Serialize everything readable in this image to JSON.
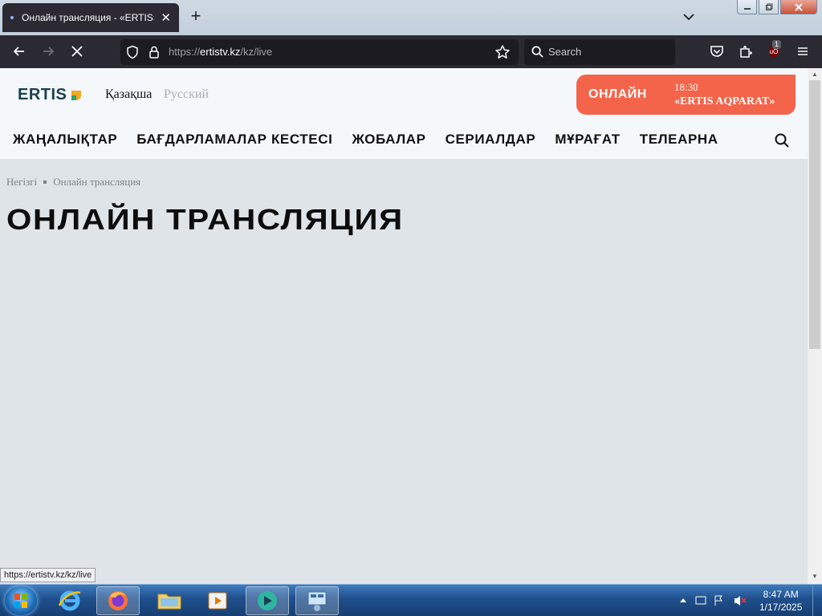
{
  "browser": {
    "tab_title": "Онлайн трансляция - «ERTIS»",
    "tab_close": "✕",
    "new_tab": "+",
    "url_prefix": "https://",
    "url_host": "ertistv.kz",
    "url_path": "/kz/live",
    "search_placeholder": "Search",
    "extension_badge": "1",
    "status_url": "https://ertistv.kz/kz/live"
  },
  "site": {
    "logo_text": "ERTIS",
    "lang_kz": "Қазақша",
    "lang_ru": "Русский",
    "live": {
      "label": "ОНЛАЙН",
      "time": "18:30",
      "show": "«ERTIS AQPARAT»"
    },
    "nav": [
      {
        "label": "ЖАҢАЛЫҚТАР"
      },
      {
        "label": "БАҒДАРЛАМАЛАР КЕСТЕСІ"
      },
      {
        "label": "ЖОБАЛАР"
      },
      {
        "label": "СЕРИАЛДАР"
      },
      {
        "label": "МҰРАҒАТ"
      },
      {
        "label": "ТЕЛЕАРНА"
      }
    ],
    "breadcrumb": [
      "Негізгі",
      "Онлайн трансляция"
    ],
    "page_title": "ОНЛАЙН ТРАНСЛЯЦИЯ"
  },
  "taskbar": {
    "time": "8:47 AM",
    "date": "1/17/2025"
  },
  "colors": {
    "accent": "#f4644a",
    "logo": "#1a3f4f",
    "page_bg": "#dfe4e8",
    "chrome": "#2b2a33"
  }
}
